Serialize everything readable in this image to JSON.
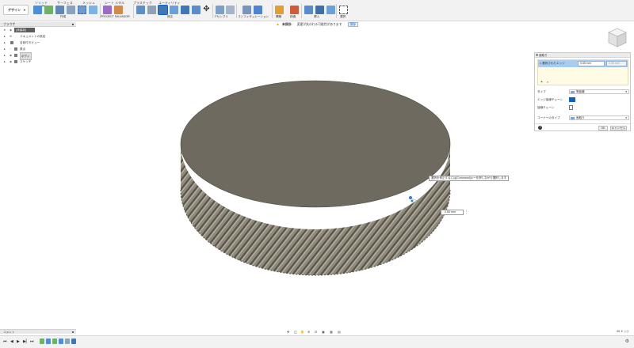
{
  "toolbar": {
    "workspace": "デザイン",
    "tabs": [
      "ソリッド",
      "サーフェス",
      "メッシュ",
      "シート メタル",
      "プラスチック",
      "ユーティリティ"
    ],
    "groups": [
      "作成",
      "PROJECT SALVADOR",
      "修正",
      "アセンブリ",
      "コンフィギュレーション",
      "構築",
      "検査",
      "挿入",
      "選択"
    ]
  },
  "warning": {
    "label": "未保存:",
    "message": "変更が失われる可能性があります",
    "button": "保存"
  },
  "browser": {
    "title": "ブラウザ",
    "items": [
      {
        "label": "(未保存)",
        "root": true
      },
      {
        "label": "ドキュメントの設定"
      },
      {
        "label": "名前付きビュー"
      },
      {
        "label": "原点"
      },
      {
        "label": "ボディ"
      },
      {
        "label": "スケッチ"
      }
    ]
  },
  "panel": {
    "title": "面取り",
    "edges_label": "1 選択されたエッジ",
    "distance1": "0.55 mm",
    "distance2": "0.55 mm",
    "type_label": "タイプ",
    "type_value": "等距離",
    "tangent_label": "エッジ接線チェーン",
    "chain_label": "接線チェーン",
    "corner_label": "コーナーのタイプ",
    "corner_value": "面取り",
    "ok": "OK",
    "cancel": "キャンセル"
  },
  "tooltip": "選択を修正するには[Command]キーを押しながら選択します",
  "dimension_value": "0.55 mm",
  "comments": {
    "title": "コメント"
  },
  "status": {
    "selection": "45 エッジ"
  },
  "colors": {
    "accent": "#0b63c4",
    "gear_face": "#6e6a5f",
    "gear_side": "#8a8577",
    "selection": "#a8cdf0"
  }
}
